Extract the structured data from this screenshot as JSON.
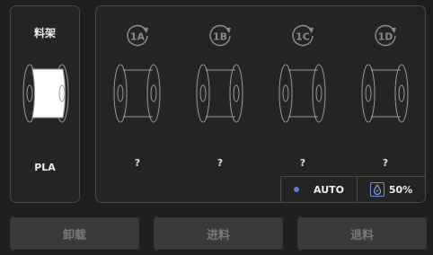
{
  "rack": {
    "title": "料架",
    "material": "PLA",
    "spool_color": "#ffffff"
  },
  "ams": {
    "slots": [
      {
        "label": "1A",
        "status": "?"
      },
      {
        "label": "1B",
        "status": "?"
      },
      {
        "label": "1C",
        "status": "?"
      },
      {
        "label": "1D",
        "status": "?"
      }
    ],
    "mode": "AUTO",
    "humidity": "50%"
  },
  "actions": {
    "unload": "卸载",
    "feed": "进料",
    "retract": "退料"
  },
  "colors": {
    "accent": "#5a7fd6",
    "panel_border": "#4a4a4a",
    "button_bg": "#3a3a3a",
    "button_text": "#7a7a7a"
  }
}
